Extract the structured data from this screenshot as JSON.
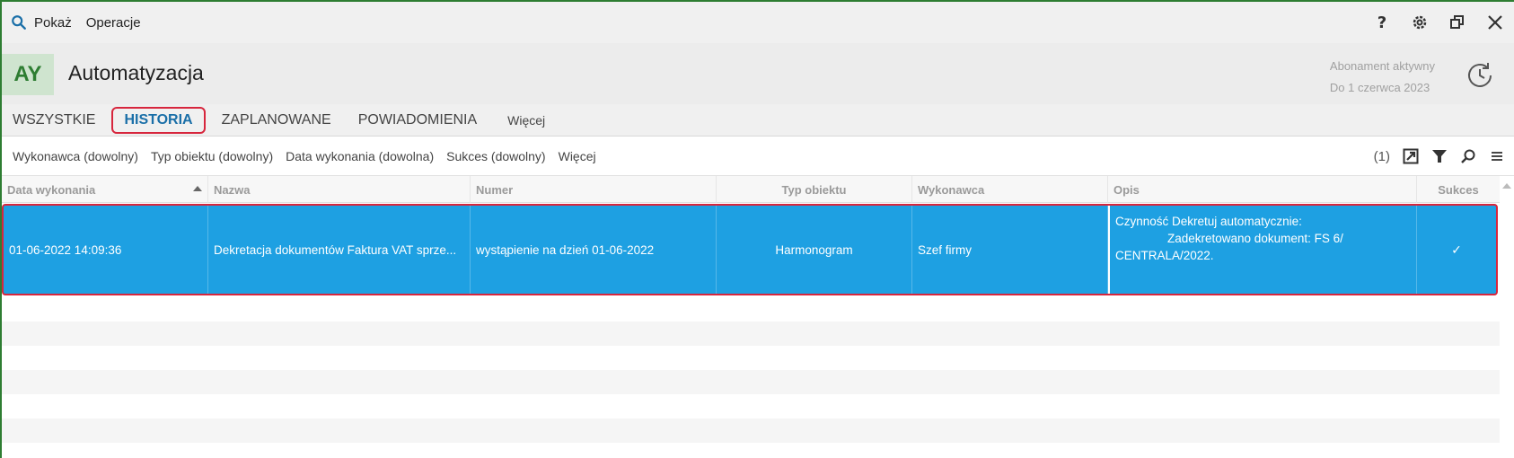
{
  "menubar": {
    "show_label": "Pokaż",
    "operations_label": "Operacje"
  },
  "header": {
    "badge": "AY",
    "title": "Automatyzacja",
    "subscription_status": "Abonament aktywny",
    "subscription_until": "Do 1 czerwca 2023"
  },
  "tabs": [
    {
      "label": "WSZYSTKIE",
      "active": false
    },
    {
      "label": "HISTORIA",
      "active": true
    },
    {
      "label": "ZAPLANOWANE",
      "active": false
    },
    {
      "label": "POWIADOMIENIA",
      "active": false
    },
    {
      "label": "Więcej",
      "active": false
    }
  ],
  "filters": [
    "Wykonawca (dowolny)",
    "Typ obiektu (dowolny)",
    "Data wykonania (dowolna)",
    "Sukces (dowolny)",
    "Więcej"
  ],
  "filter_count": "(1)",
  "table": {
    "columns": [
      "Data wykonania",
      "Nazwa",
      "Numer",
      "Typ obiektu",
      "Wykonawca",
      "Opis",
      "Sukces"
    ],
    "rows": [
      {
        "data_wykonania": "01-06-2022 14:09:36",
        "nazwa": "Dekretacja dokumentów Faktura VAT sprze...",
        "numer": "wystąpienie na dzień 01-06-2022",
        "typ_obiektu": "Harmonogram",
        "wykonawca": "Szef firmy",
        "opis_line1": "Czynność Dekretuj automatycznie:",
        "opis_line2": "Zadekretowano dokument: FS 6/",
        "opis_line3": "CENTRALA/2022.",
        "sukces": "✓"
      }
    ]
  },
  "colors": {
    "selected_row": "#1ea0e2",
    "accent_blue": "#1a6fa8",
    "highlight_red": "#d7263d",
    "badge_green": "#2e7d32"
  }
}
